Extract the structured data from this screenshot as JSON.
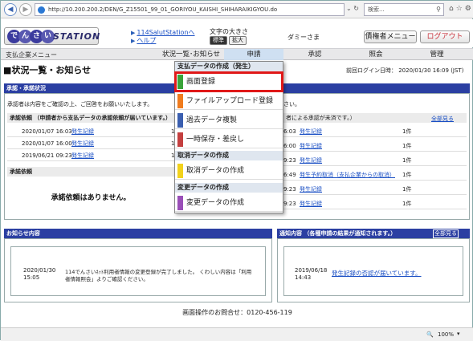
{
  "browser": {
    "url": "http://10.200.200.2/DEN/G_Z15501_99_01_GORIYOU_KAISHI_SHIHARAIKIGYOU.do",
    "search_placeholder": "検索...",
    "zoom": "100%"
  },
  "header": {
    "logo_chars": [
      "で",
      "ん",
      "さ",
      "い"
    ],
    "logo_station": "STATION",
    "link1": "114SalutStationへ",
    "link2": "ヘルプ",
    "font_size_label": "文字の大きさ",
    "font_std": "標準",
    "font_big": "拡大",
    "user": "ダミーさま",
    "btn_menu": "債権者メニュー",
    "btn_logout": "ログアウト"
  },
  "menubar": {
    "left": "支払企業メニュー",
    "items": [
      "状況一覧･お知らせ",
      "申請",
      "承認",
      "照会",
      "管理"
    ]
  },
  "page": {
    "title": "■状況一覧・お知らせ",
    "last_login": "前回ログイン日時： 2020/01/30 16:09 (JST)"
  },
  "approval": {
    "head": "承認・承諾状況",
    "intro": "承認者は内容をご確認の上、ご回答をお願いいたします。",
    "intro_right": "さい。",
    "left_sub": "承認依頼 （申請者から支払データの承認依頼が届いています。）",
    "left_rows": [
      {
        "date": "2020/01/07 16:03",
        "link": "発生記録",
        "n": "1"
      },
      {
        "date": "2020/01/07 16:00",
        "link": "発生記録",
        "n": "1"
      },
      {
        "date": "2019/06/21 09:23",
        "link": "発生記録",
        "n": "1"
      }
    ],
    "right_sub": "者による承認が未済です。）",
    "see_all": "全部見る",
    "right_rows": [
      {
        "date": "6:03",
        "link": "発生記録",
        "n": "1件"
      },
      {
        "date": "6:00",
        "link": "発生記録",
        "n": "1件"
      },
      {
        "date": "9:23",
        "link": "発生記録",
        "n": "1件"
      },
      {
        "date": "6:49",
        "link": "発生予約取消（支払企業からの取消）",
        "n": "1件"
      },
      {
        "date": "9:23",
        "link": "発生記録",
        "n": "1件"
      },
      {
        "date": "9:23",
        "link": "発生記録",
        "n": "1件"
      }
    ],
    "consent_sub": "承諾依頼",
    "no_consent": "承諾依頼はありません。"
  },
  "notices": {
    "head": "お知らせ内容",
    "date": "2020/01/30",
    "time": "15:05",
    "text1": "114でんさいﾈｯﾄ利用者情報の変更登録が完了しました。 くわしい内容は「利用",
    "text2": "者情報照会」よりご確認ください。"
  },
  "alerts": {
    "head": "通知内容 （各種申請の結果が通知されます。）",
    "see_all": "全部見る",
    "date": "2019/06/18",
    "time": "14:43",
    "link": "発生記録の否認が届いています。"
  },
  "footer": "画面操作のお問合せ：0120-456-119",
  "dropdown": {
    "sec1": "支払データの作成（発生）",
    "item1": "画面登録",
    "item2": "ファイルアップロード登録",
    "item3": "過去データ複製",
    "item4": "一時保存・差戻し",
    "sec2": "取消データの作成",
    "item5": "取消データの作成",
    "sec3": "変更データの作成",
    "item6": "変更データの作成",
    "colors": {
      "item1": "#3aa33a",
      "item2": "#f07c1e",
      "item3": "#3b5fb0",
      "item4": "#c44040",
      "item5": "#f2d21c",
      "item6": "#9a4fb8",
      "highlight": "#e01818"
    }
  }
}
